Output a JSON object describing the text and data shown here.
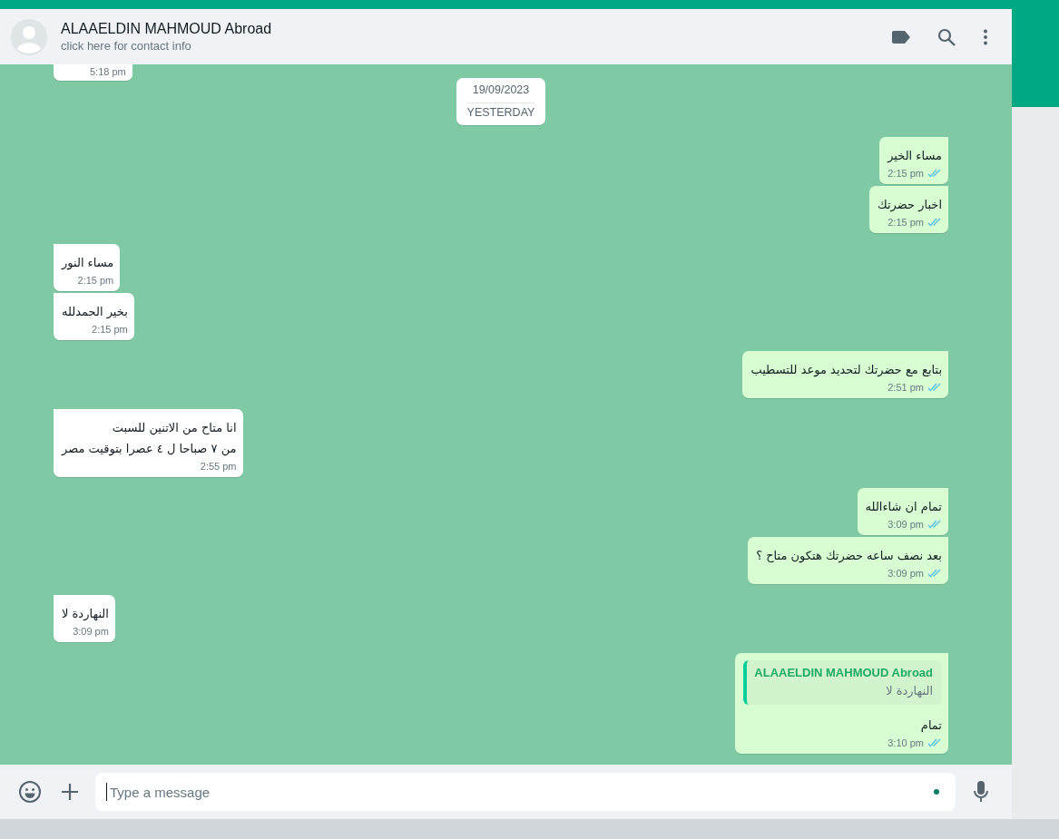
{
  "header": {
    "contact_name": "ALAAELDIN MAHMOUD Abroad",
    "subtitle": "click here for contact info"
  },
  "top_partial_message": {
    "time": "5:18 pm"
  },
  "date_chip": {
    "date": "19/09/2023",
    "label": "YESTERDAY"
  },
  "messages": [
    {
      "kind": "out",
      "text": "مساء الخير",
      "time": "2:15 pm",
      "read": true
    },
    {
      "kind": "out",
      "text": "اخبار حضرتك",
      "time": "2:15 pm",
      "read": true
    },
    {
      "kind": "in",
      "text": "مساء النور",
      "time": "2:15 pm"
    },
    {
      "kind": "in",
      "text": "بخير الحمدلله",
      "time": "2:15 pm"
    },
    {
      "kind": "out",
      "text": "بتابع مع حضرتك لتحديد موعد للتسطيب",
      "time": "2:51 pm",
      "read": true
    },
    {
      "kind": "in",
      "lines": [
        "انا متاح من الاتنين للسبت",
        "من ٧ صباحا ل ٤ عصرا بتوقيت مصر"
      ],
      "time": "2:55 pm"
    },
    {
      "kind": "out",
      "text": "تمام ان شاءالله",
      "time": "3:09 pm",
      "read": true
    },
    {
      "kind": "out",
      "text": "بعد نصف ساعه حضرتك هتكون متاح ؟",
      "time": "3:09 pm",
      "read": true
    },
    {
      "kind": "in",
      "text": "النهاردة لا",
      "time": "3:09 pm"
    },
    {
      "kind": "out",
      "reply_to": {
        "name": "ALAAELDIN MAHMOUD Abroad",
        "text": "النهاردة لا"
      },
      "text": "تمام",
      "time": "3:10 pm",
      "read": true
    }
  ],
  "composer": {
    "placeholder": "Type a message"
  }
}
